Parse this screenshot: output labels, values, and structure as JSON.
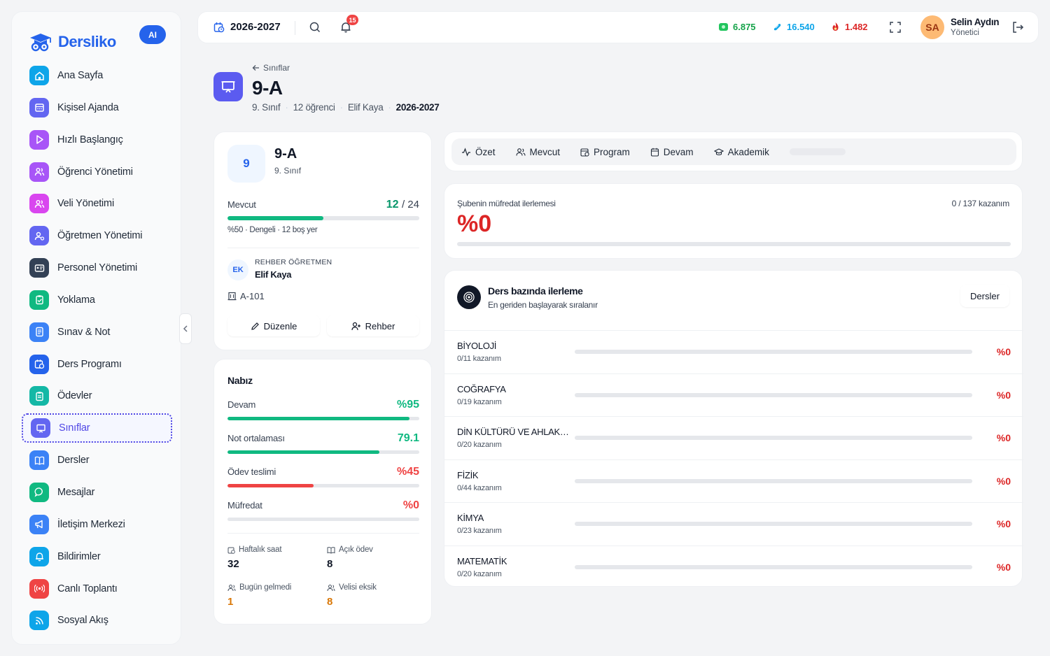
{
  "brand": {
    "name": "Dersliko",
    "ai_label": "AI"
  },
  "sidebar": {
    "items": [
      {
        "label": "Ana Sayfa",
        "icon": "home-icon",
        "color": "#0ea5e9"
      },
      {
        "label": "Kişisel Ajanda",
        "icon": "calendar-icon",
        "color": "#6366f1"
      },
      {
        "label": "Hızlı Başlangıç",
        "icon": "play-icon",
        "color": "#a855f7"
      },
      {
        "label": "Öğrenci Yönetimi",
        "icon": "users-icon",
        "color": "#a855f7"
      },
      {
        "label": "Veli Yönetimi",
        "icon": "users-icon",
        "color": "#d946ef"
      },
      {
        "label": "Öğretmen Yönetimi",
        "icon": "teacher-icon",
        "color": "#6366f1"
      },
      {
        "label": "Personel Yönetimi",
        "icon": "id-card-icon",
        "color": "#334155"
      },
      {
        "label": "Yoklama",
        "icon": "clipboard-check-icon",
        "color": "#10b981"
      },
      {
        "label": "Sınav & Not",
        "icon": "document-icon",
        "color": "#3b82f6"
      },
      {
        "label": "Ders Programı",
        "icon": "calendar-clock-icon",
        "color": "#2563eb"
      },
      {
        "label": "Ödevler",
        "icon": "clipboard-list-icon",
        "color": "#14b8a6"
      },
      {
        "label": "Sınıflar",
        "icon": "presentation-icon",
        "color": "#6366f1",
        "active": true
      },
      {
        "label": "Dersler",
        "icon": "book-icon",
        "color": "#3b82f6"
      },
      {
        "label": "Mesajlar",
        "icon": "chat-icon",
        "color": "#10b981"
      },
      {
        "label": "İletişim Merkezi",
        "icon": "megaphone-icon",
        "color": "#3b82f6"
      },
      {
        "label": "Bildirimler",
        "icon": "bell-icon",
        "color": "#0ea5e9"
      },
      {
        "label": "Canlı Toplantı",
        "icon": "broadcast-icon",
        "color": "#ef4444"
      },
      {
        "label": "Sosyal Akış",
        "icon": "rss-icon",
        "color": "#0ea5e9"
      }
    ]
  },
  "topbar": {
    "year": "2026-2027",
    "notification_count": "15",
    "stats": [
      {
        "value": "6.875",
        "color": "#16a34a",
        "icon": "money-icon"
      },
      {
        "value": "16.540",
        "color": "#0ea5e9",
        "icon": "gem-icon"
      },
      {
        "value": "1.482",
        "color": "#dc2626",
        "icon": "fire-icon"
      }
    ],
    "user": {
      "initials": "SA",
      "name": "Selin Aydın",
      "role": "Yönetici"
    }
  },
  "header": {
    "back_label": "Sınıflar",
    "title": "9-A",
    "meta": {
      "grade": "9. Sınıf",
      "students": "12 öğrenci",
      "teacher": "Elif Kaya",
      "year": "2026-2027"
    }
  },
  "class_card": {
    "avatar": "9",
    "name": "9-A",
    "grade": "9. Sınıf",
    "mevcut_label": "Mevcut",
    "mevcut_current": "12",
    "mevcut_total": "/ 24",
    "mevcut_fraction": 0.5,
    "mevcut_note": "%50 · Dengeli · 12 boş yer",
    "teacher_initials": "EK",
    "teacher_role": "REHBER ÖĞRETMEN",
    "teacher_name": "Elif Kaya",
    "room": "A-101",
    "edit_label": "Düzenle",
    "guide_label": "Rehber"
  },
  "pulse": {
    "title": "Nabız",
    "metrics": [
      {
        "label": "Devam",
        "value": "%95",
        "fraction": 0.95,
        "color": "#10b981"
      },
      {
        "label": "Not ortalaması",
        "value": "79.1",
        "fraction": 0.791,
        "color": "#10b981"
      },
      {
        "label": "Ödev teslimi",
        "value": "%45",
        "fraction": 0.45,
        "color": "#ef4444"
      },
      {
        "label": "Müfredat",
        "value": "%0",
        "fraction": 0,
        "color": "#ef4444"
      }
    ],
    "minis": [
      {
        "label": "Haftalık saat",
        "value": "32",
        "color": "#111827"
      },
      {
        "label": "Açık ödev",
        "value": "8",
        "color": "#111827"
      },
      {
        "label": "Bugün gelmedi",
        "value": "1",
        "color": "#d97706"
      },
      {
        "label": "Velisi eksik",
        "value": "8",
        "color": "#d97706"
      }
    ]
  },
  "tabs": [
    {
      "label": "Özet"
    },
    {
      "label": "Mevcut"
    },
    {
      "label": "Program"
    },
    {
      "label": "Devam"
    },
    {
      "label": "Akademik"
    }
  ],
  "curriculum": {
    "label": "Şubenin müfredat ilerlemesi",
    "count": "0 / 137 kazanım",
    "percent": "%0"
  },
  "subjects": {
    "title": "Ders bazında ilerleme",
    "subtitle": "En geriden başlayarak sıralanır",
    "button": "Dersler",
    "items": [
      {
        "name": "BİYOLOJİ",
        "count": "0/11 kazanım",
        "pct": "%0"
      },
      {
        "name": "COĞRAFYA",
        "count": "0/19 kazanım",
        "pct": "%0"
      },
      {
        "name": "DİN KÜLTÜRÜ VE AHLAK ...",
        "count": "0/20 kazanım",
        "pct": "%0"
      },
      {
        "name": "FİZİK",
        "count": "0/44 kazanım",
        "pct": "%0"
      },
      {
        "name": "KİMYA",
        "count": "0/23 kazanım",
        "pct": "%0"
      },
      {
        "name": "MATEMATİK",
        "count": "0/20 kazanım",
        "pct": "%0"
      }
    ]
  }
}
